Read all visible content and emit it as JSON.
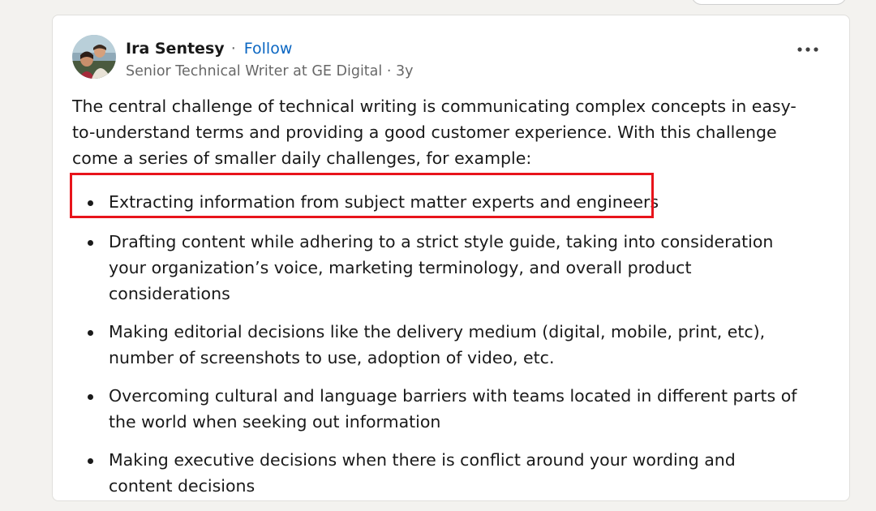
{
  "post": {
    "author_name": "Ira Sentesy",
    "separator": "·",
    "follow_label": "Follow",
    "author_headline": "Senior Technical Writer at GE Digital · 3y",
    "intro": "The central challenge of technical writing is communicating complex concepts in easy-to-understand terms and providing a good customer experience. With this challenge come a series of smaller daily challenges, for example:",
    "bullets": [
      "Extracting information from subject matter experts and engineers",
      "Drafting content while adhering to a strict style guide, taking into consideration your organization’s voice, marketing terminology, and overall product considerations",
      "Making editorial decisions like the delivery medium (digital, mobile, print, etc), number of screenshots to use, adoption of video, etc.",
      "Overcoming cultural and language barriers with teams located in different parts of the world when seeking out information",
      "Making executive decisions when there is conflict around your wording and content decisions"
    ],
    "more_icon": "more-horizontal-icon",
    "highlight_color": "#e8141b",
    "follow_color": "#0a66c2"
  }
}
